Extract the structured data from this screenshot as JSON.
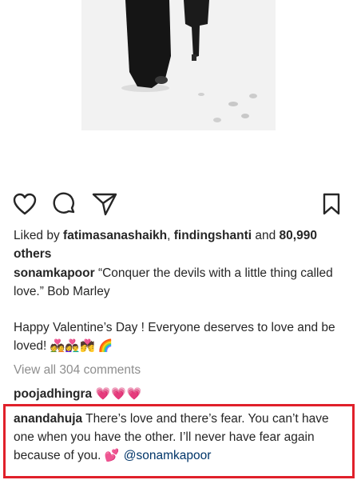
{
  "actions": {
    "like_icon": "heart-outline-icon",
    "comment_icon": "comment-bubble-icon",
    "share_icon": "paper-plane-icon",
    "save_icon": "bookmark-icon"
  },
  "likes": {
    "prefix": "Liked by ",
    "user1": "fatimasanashaikh",
    "separator": ", ",
    "user2": "findingshanti",
    "and": " and ",
    "count": "80,990 others"
  },
  "caption": {
    "username": "sonamkapoor",
    "text": " “Conquer the devils with a little thing called love.” Bob Marley"
  },
  "greeting": {
    "text": "Happy Valentine’s Day !  Everyone deserves to love and be loved! ",
    "emojis": "💑👩‍❤️‍👨💏 🌈"
  },
  "view_all_comments": "View all 304 comments",
  "comments": [
    {
      "username": "poojadhingra",
      "text": "💗💗💗"
    },
    {
      "username": "anandahuja",
      "text": " There’s love and there’s fear. You can’t have one when you have the other. I’ll never have fear again because of you. ",
      "emoji": "💕",
      "mention": " @sonamkapoor"
    }
  ],
  "colors": {
    "highlight": "#e0202a",
    "heart": "#e8578a",
    "mention": "#003569",
    "muted": "#8e8e8e"
  }
}
